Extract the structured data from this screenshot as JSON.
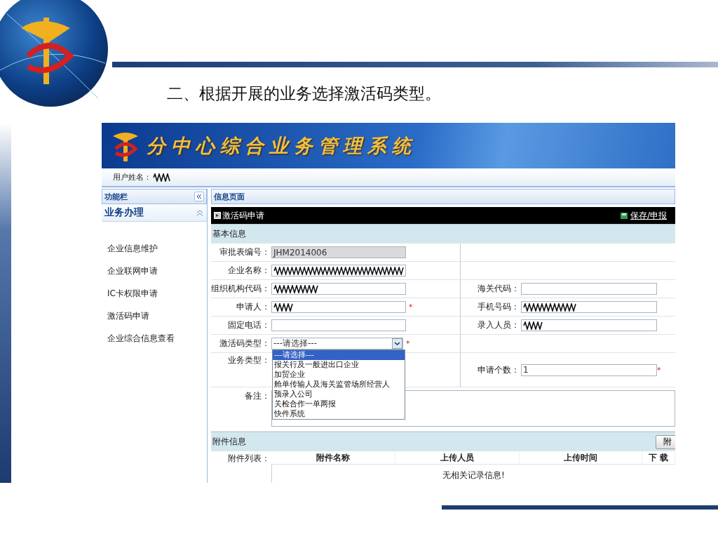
{
  "slide_title": "二、根据开展的业务选择激活码类型。",
  "banner": {
    "title": "分中心综合业务管理系统"
  },
  "user_bar": {
    "label": "用户姓名：",
    "redacted": true
  },
  "sidebar": {
    "header": "功能栏",
    "section": "业务办理",
    "expanded": true,
    "items": [
      {
        "label": "企业信息维护"
      },
      {
        "label": "企业联网申请"
      },
      {
        "label": "IC卡权限申请"
      },
      {
        "label": "激活码申请"
      },
      {
        "label": "企业综合信息查看"
      }
    ]
  },
  "main": {
    "header": "信息页面",
    "toolbar": {
      "title": "激活码申请",
      "action": "保存/申报"
    },
    "section": "基本信息",
    "rows": [
      {
        "left": {
          "label": "审批表编号：",
          "kind": "readonly",
          "value": "JHM2014006"
        }
      },
      {
        "left": {
          "label": "企业名称：",
          "kind": "text",
          "redacted": true
        }
      },
      {
        "left": {
          "label": "组织机构代码：",
          "kind": "text",
          "redacted": true
        },
        "right": {
          "label": "海关代码：",
          "kind": "text"
        }
      },
      {
        "left": {
          "label": "申请人：",
          "kind": "text",
          "redacted": true,
          "mark": "*"
        },
        "right": {
          "label": "手机号码：",
          "kind": "text",
          "redacted": true
        }
      },
      {
        "left": {
          "label": "固定电话：",
          "kind": "text"
        },
        "right": {
          "label": "录入人员：",
          "kind": "text",
          "redacted": true
        }
      },
      {
        "left": {
          "label": "激活码类型：",
          "kind": "select",
          "value": "---请选择---",
          "mark": "*"
        }
      },
      {
        "left": {
          "label": "业务类型：",
          "kind": "covered"
        },
        "right": {
          "label": "申请个数：",
          "kind": "text",
          "value": "1",
          "mark": "*"
        }
      },
      {
        "left": {
          "label": "备注：",
          "kind": "textarea"
        }
      }
    ],
    "dropdown": {
      "options": [
        {
          "label": "---请选择---",
          "selected": true
        },
        {
          "label": "报关行及一般进出口企业",
          "selected": false
        },
        {
          "label": "加贸企业",
          "selected": false
        },
        {
          "label": "舱单传输人及海关监管场所经营人",
          "selected": false
        },
        {
          "label": "预录入公司",
          "selected": false
        },
        {
          "label": "关检合作一单两报",
          "selected": false
        },
        {
          "label": "快件系统",
          "selected": false
        }
      ]
    },
    "attachments": {
      "section": "附件信息",
      "button": "附",
      "list_label": "附件列表：",
      "columns": [
        "附件名称",
        "上传人员",
        "上传时间",
        "下 载"
      ],
      "empty_message": "无相关记录信息!"
    }
  }
}
